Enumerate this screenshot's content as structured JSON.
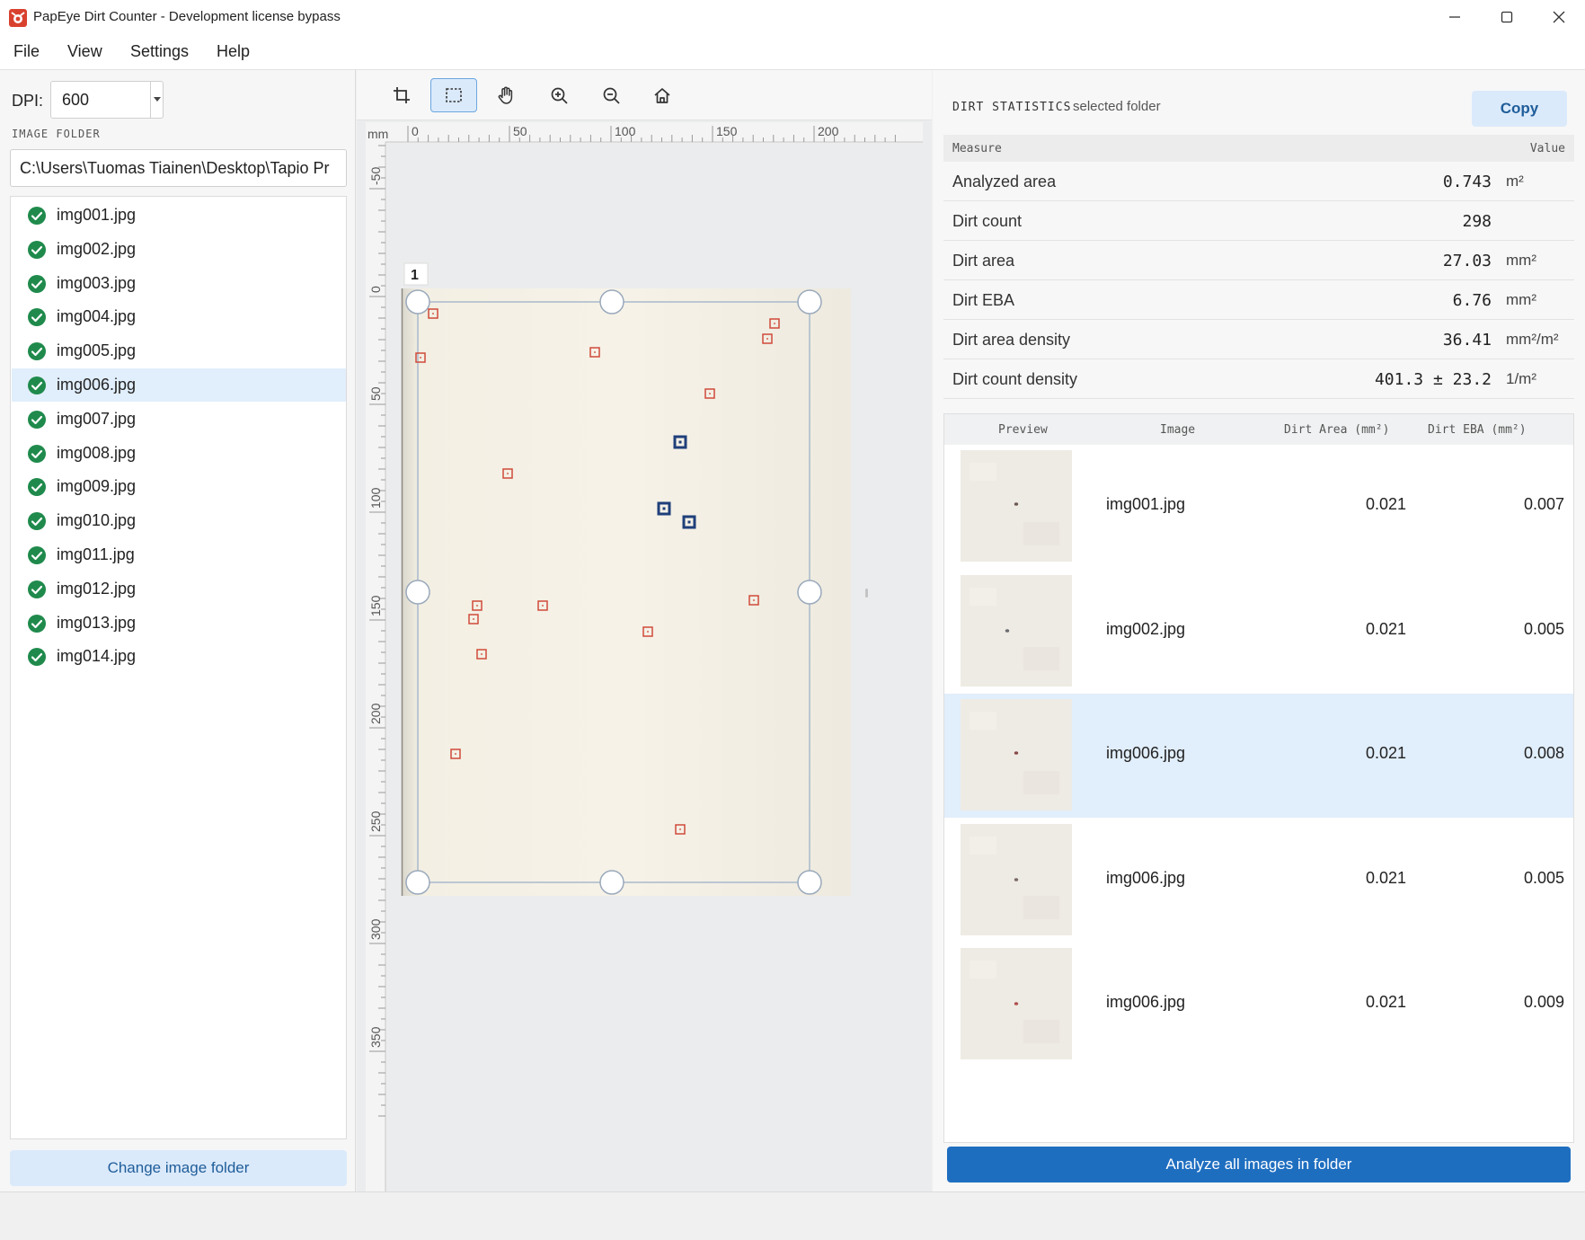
{
  "window": {
    "title": "PapEye Dirt Counter - Development license bypass"
  },
  "menu": [
    "File",
    "View",
    "Settings",
    "Help"
  ],
  "left": {
    "dpi_label": "DPI:",
    "dpi_value": "600",
    "folder_heading": "IMAGE FOLDER",
    "folder_path": "C:\\Users\\Tuomas Tiainen\\Desktop\\Tapio Pr",
    "files": [
      {
        "name": "img001.jpg",
        "status": "done",
        "selected": false
      },
      {
        "name": "img002.jpg",
        "status": "done",
        "selected": false
      },
      {
        "name": "img003.jpg",
        "status": "done",
        "selected": false
      },
      {
        "name": "img004.jpg",
        "status": "done",
        "selected": false
      },
      {
        "name": "img005.jpg",
        "status": "done",
        "selected": false
      },
      {
        "name": "img006.jpg",
        "status": "done",
        "selected": true
      },
      {
        "name": "img007.jpg",
        "status": "done",
        "selected": false
      },
      {
        "name": "img008.jpg",
        "status": "done",
        "selected": false
      },
      {
        "name": "img009.jpg",
        "status": "done",
        "selected": false
      },
      {
        "name": "img010.jpg",
        "status": "done",
        "selected": false
      },
      {
        "name": "img011.jpg",
        "status": "done",
        "selected": false
      },
      {
        "name": "img012.jpg",
        "status": "done",
        "selected": false
      },
      {
        "name": "img013.jpg",
        "status": "done",
        "selected": false
      },
      {
        "name": "img014.jpg",
        "status": "done",
        "selected": false
      }
    ],
    "change_folder_label": "Change image folder"
  },
  "toolbar": {
    "tools": [
      {
        "name": "crop-tool",
        "icon": "crop-icon",
        "active": false
      },
      {
        "name": "select-tool",
        "icon": "select-rect-icon",
        "active": true
      },
      {
        "name": "pan-tool",
        "icon": "hand-icon",
        "active": false
      },
      {
        "name": "zoom-in-tool",
        "icon": "zoom-in-icon",
        "active": false
      },
      {
        "name": "zoom-out-tool",
        "icon": "zoom-out-icon",
        "active": false
      },
      {
        "name": "home-tool",
        "icon": "home-icon",
        "active": false
      }
    ]
  },
  "viewer": {
    "ruler_unit": "mm",
    "ruler_x_ticks": [
      "0",
      "50",
      "100",
      "150",
      "200"
    ],
    "ruler_y_ticks": [
      "-50",
      "0",
      "50",
      "100",
      "150",
      "200",
      "250",
      "300",
      "350"
    ],
    "page_label": "1",
    "colors": {
      "dirt": "#d04a3a",
      "highlight": "#1f3f7a",
      "paper": "#f5f1e6"
    }
  },
  "stats": {
    "heading": "DIRT STATISTICS",
    "scope": "selected folder",
    "copy_label": "Copy",
    "col_measure": "Measure",
    "col_value": "Value",
    "rows": [
      {
        "measure": "Analyzed area",
        "value": "0.743",
        "unit": "m²"
      },
      {
        "measure": "Dirt count",
        "value": "298",
        "unit": ""
      },
      {
        "measure": "Dirt area",
        "value": "27.03",
        "unit": "mm²"
      },
      {
        "measure": "Dirt EBA",
        "value": "6.76",
        "unit": "mm²"
      },
      {
        "measure": "Dirt area density",
        "value": "36.41",
        "unit": "mm²/m²"
      },
      {
        "measure": "Dirt count density",
        "value": "401.3 ± 23.2",
        "unit": "1/m²"
      }
    ]
  },
  "images": {
    "columns": [
      "Preview",
      "Image",
      "Dirt Area (mm²)",
      "Dirt EBA (mm²)"
    ],
    "rows": [
      {
        "image": "img001.jpg",
        "area": "0.021",
        "eba": "0.007",
        "selected": false
      },
      {
        "image": "img002.jpg",
        "area": "0.021",
        "eba": "0.005",
        "selected": false
      },
      {
        "image": "img006.jpg",
        "area": "0.021",
        "eba": "0.008",
        "selected": true
      },
      {
        "image": "img006.jpg",
        "area": "0.021",
        "eba": "0.005",
        "selected": false
      },
      {
        "image": "img006.jpg",
        "area": "0.021",
        "eba": "0.009",
        "selected": false
      }
    ],
    "analyze_label": "Analyze all images in folder"
  }
}
